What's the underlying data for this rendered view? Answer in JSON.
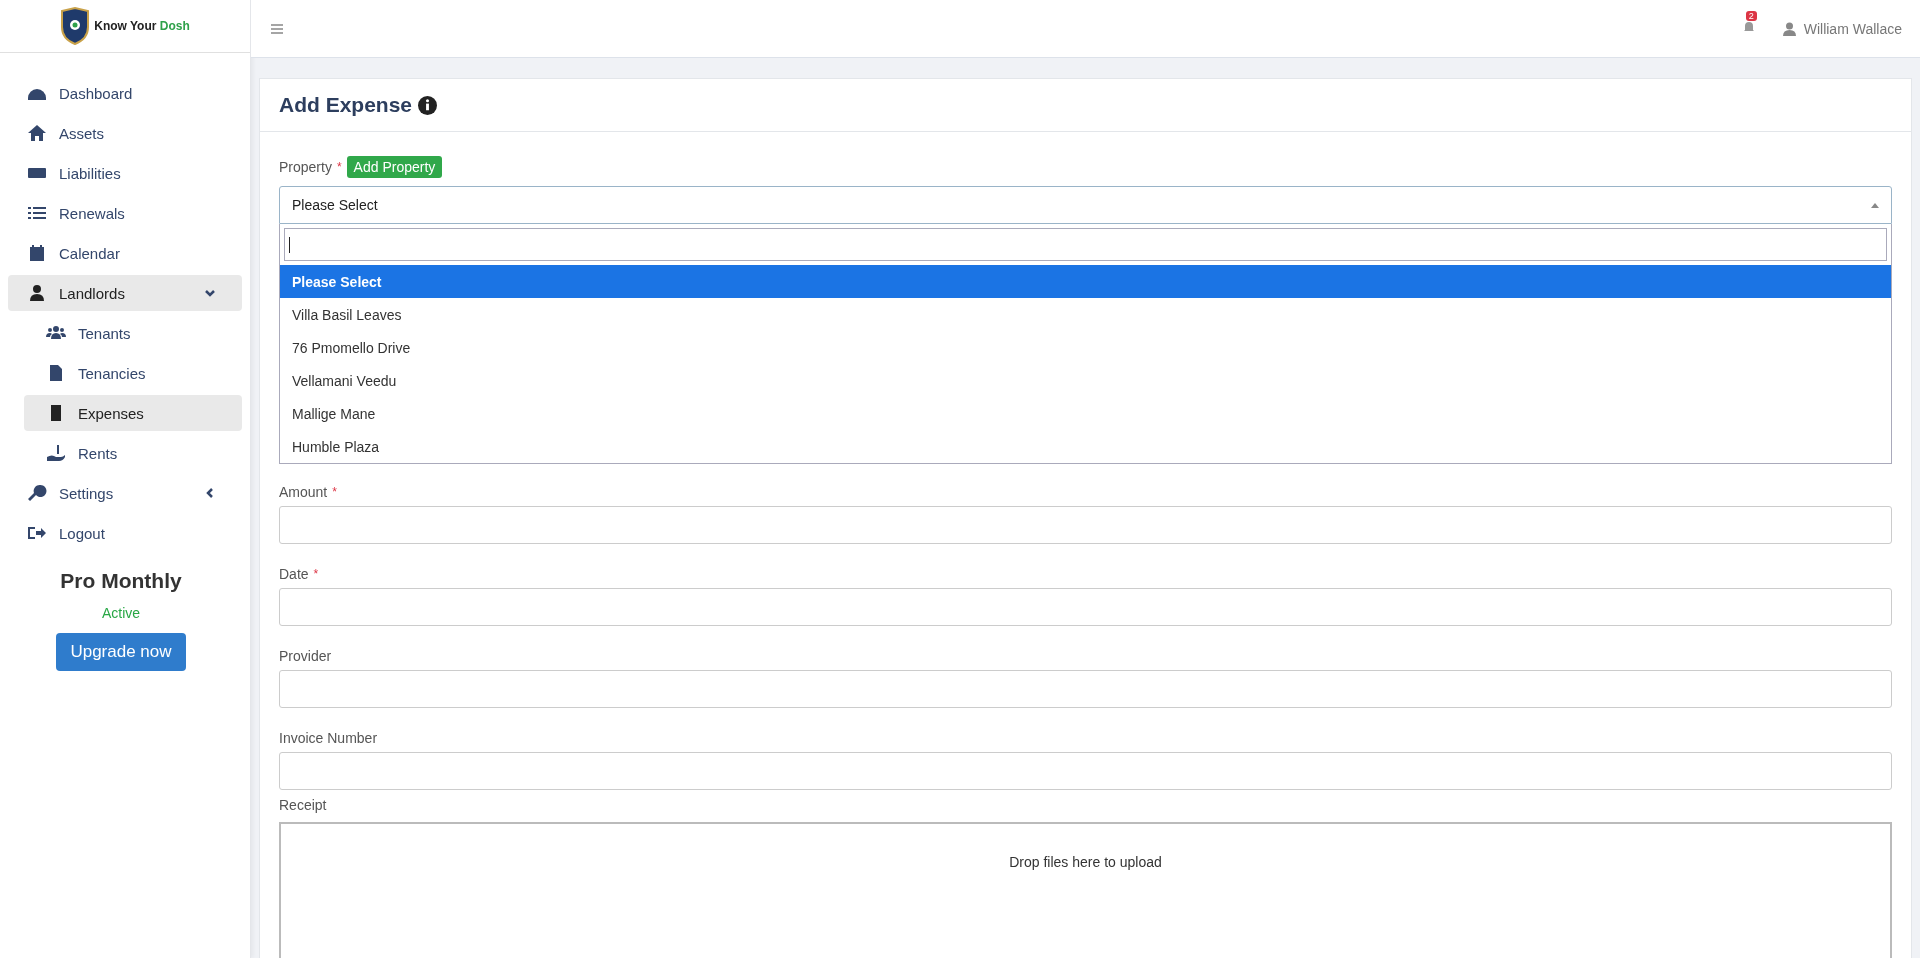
{
  "brand": {
    "name_part1": "Know Your ",
    "name_part2": "Dosh"
  },
  "sidebar": {
    "items": [
      {
        "label": "Dashboard",
        "selected": false
      },
      {
        "label": "Assets",
        "selected": false
      },
      {
        "label": "Liabilities",
        "selected": false
      },
      {
        "label": "Renewals",
        "selected": false
      },
      {
        "label": "Calendar",
        "selected": false
      },
      {
        "label": "Landlords",
        "selected": true,
        "expanded": true,
        "children": [
          {
            "label": "Tenants",
            "selected": false
          },
          {
            "label": "Tenancies",
            "selected": false
          },
          {
            "label": "Expenses",
            "selected": true
          },
          {
            "label": "Rents",
            "selected": false
          }
        ]
      },
      {
        "label": "Settings",
        "selected": false,
        "expanded": false
      },
      {
        "label": "Logout",
        "selected": false
      }
    ],
    "plan": {
      "name": "Pro Monthly",
      "status": "Active",
      "button": "Upgrade now"
    }
  },
  "header": {
    "notifications": "2",
    "user": "William Wallace"
  },
  "form": {
    "title": "Add Expense",
    "property": {
      "label": "Property",
      "required_mark": "*",
      "add_button": "Add Property",
      "value": "Please Select",
      "options": [
        {
          "label": "Please Select",
          "selected": true
        },
        {
          "label": "Villa Basil Leaves",
          "selected": false
        },
        {
          "label": "76 Pmomello Drive",
          "selected": false
        },
        {
          "label": "Vellamani Veedu",
          "selected": false
        },
        {
          "label": "Mallige Mane",
          "selected": false
        },
        {
          "label": "Humble Plaza",
          "selected": false
        }
      ]
    },
    "fields": [
      {
        "label": "Amount",
        "required": true
      },
      {
        "label": "Date",
        "required": true
      },
      {
        "label": "Provider",
        "required": false
      },
      {
        "label": "Invoice Number",
        "required": false
      }
    ],
    "receipt": {
      "label": "Receipt",
      "dropzone": "Drop files here to upload"
    }
  }
}
